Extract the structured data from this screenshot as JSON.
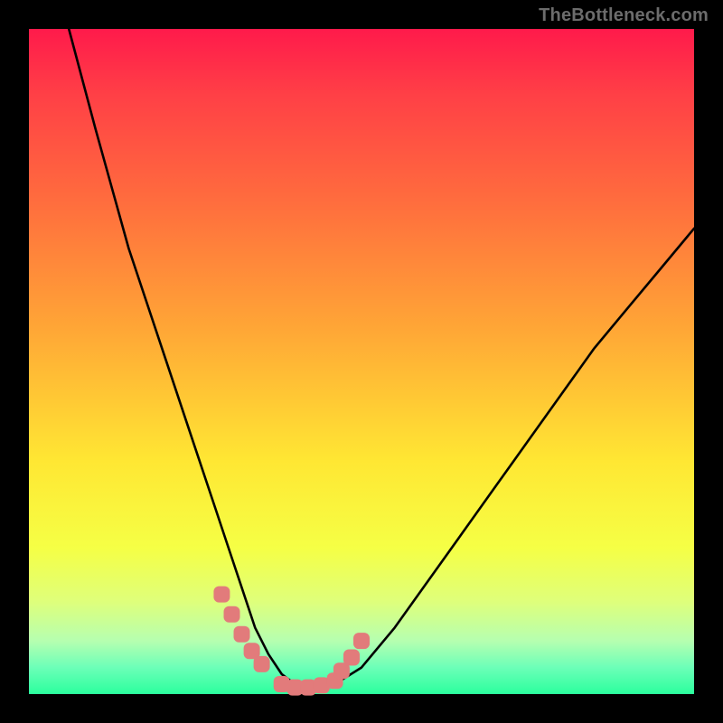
{
  "watermark": "TheBottleneck.com",
  "colors": {
    "frame": "#000000",
    "gradient_top": "#ff1a4b",
    "gradient_bottom": "#2bff9d",
    "curve": "#000000",
    "marker": "#e27b7b"
  },
  "chart_data": {
    "type": "line",
    "title": "",
    "xlabel": "",
    "ylabel": "",
    "xlim": [
      0,
      100
    ],
    "ylim": [
      0,
      100
    ],
    "grid": false,
    "legend": false,
    "annotations": [
      "TheBottleneck.com"
    ],
    "series": [
      {
        "name": "bottleneck-curve",
        "x": [
          6,
          10,
          15,
          20,
          25,
          28,
          30,
          32,
          34,
          36,
          38,
          40,
          43,
          46,
          50,
          55,
          60,
          65,
          70,
          75,
          80,
          85,
          90,
          95,
          100
        ],
        "values": [
          100,
          85,
          67,
          52,
          37,
          28,
          22,
          16,
          10,
          6,
          3,
          1.5,
          1,
          1.5,
          4,
          10,
          17,
          24,
          31,
          38,
          45,
          52,
          58,
          64,
          70
        ]
      }
    ],
    "markers": {
      "name": "highlighted-points",
      "shape": "rounded-square",
      "color": "#e27b7b",
      "x": [
        29,
        30.5,
        32,
        33.5,
        35,
        38,
        40,
        42,
        44,
        46,
        47,
        48.5,
        50
      ],
      "values": [
        15,
        12,
        9,
        6.5,
        4.5,
        1.5,
        1,
        1,
        1.3,
        2,
        3.5,
        5.5,
        8
      ]
    }
  }
}
